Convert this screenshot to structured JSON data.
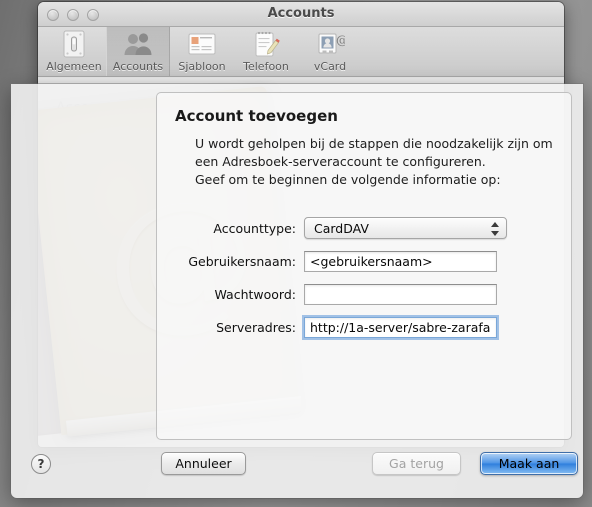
{
  "window": {
    "title": "Accounts",
    "traffic_lights": [
      "close",
      "minimize",
      "zoom"
    ]
  },
  "toolbar": {
    "items": [
      {
        "label": "Algemeen",
        "icon": "light-switch-icon",
        "selected": false
      },
      {
        "label": "Accounts",
        "icon": "people-icon",
        "selected": true
      },
      {
        "label": "Sjabloon",
        "icon": "card-template-icon",
        "selected": false
      },
      {
        "label": "Telefoon",
        "icon": "notepad-pencil-icon",
        "selected": false
      },
      {
        "label": "vCard",
        "icon": "vcard-icon",
        "selected": false
      }
    ]
  },
  "background": {
    "ghost_label": "Accounts",
    "book_glyph": "@"
  },
  "sheet": {
    "heading": "Account toevoegen",
    "description_line1": "U wordt geholpen bij de stappen die noodzakelijk zijn om",
    "description_line2": "een Adresboek-serveraccount te configureren.",
    "description_line3": "Geef om te beginnen de volgende informatie op:",
    "fields": [
      {
        "label": "Accounttype:",
        "type": "popup",
        "value": "CardDAV",
        "options": [
          "CardDAV"
        ],
        "focused": false
      },
      {
        "label": "Gebruikersnaam:",
        "type": "text",
        "value": "<gebruikersnaam>",
        "placeholder": "",
        "focused": false
      },
      {
        "label": "Wachtwoord:",
        "type": "text",
        "value": "",
        "placeholder": "",
        "focused": false
      },
      {
        "label": "Serveradres:",
        "type": "text",
        "value": "http://1a-server/sabre-zarafa",
        "placeholder": "",
        "focused": true
      }
    ]
  },
  "buttons": {
    "help": "?",
    "cancel": "Annuleer",
    "back": "Ga terug",
    "create": "Maak aan"
  },
  "colors": {
    "default_button_blue": "#2f7fdd",
    "focus_ring": "#6ca0dc",
    "book_cover": "#e4d7b2",
    "book_spine": "#a59ba0"
  }
}
